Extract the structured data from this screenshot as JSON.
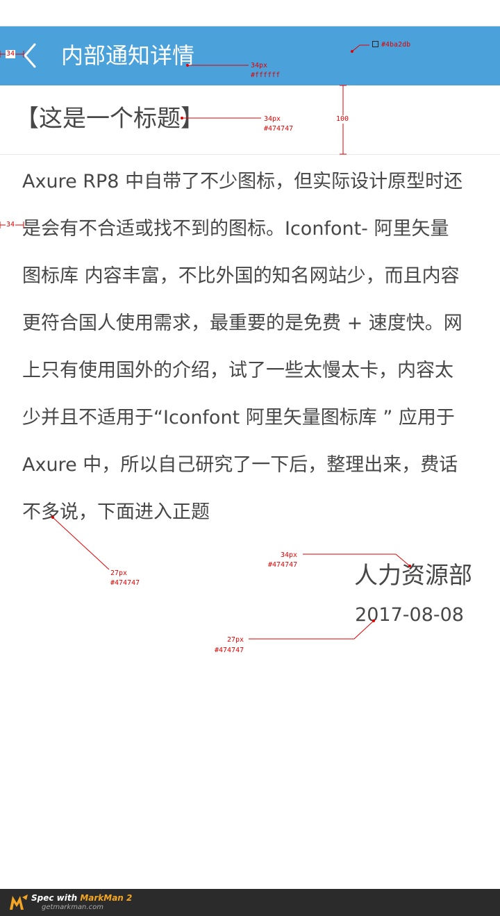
{
  "colors": {
    "nav_background": "#4ba2db",
    "nav_text": "#ffffff",
    "body_text": "#474747",
    "annotation": "#e10000",
    "footer_background": "#2b2b2b"
  },
  "nav": {
    "back_icon": "chevron-left-icon",
    "title": "内部通知详情"
  },
  "notice": {
    "title": "【这是一个标题】",
    "body_lines": [
      "Axure RP8 中自带了不少图标，但实际设计原型时还",
      "是会有不合适或找不到的图标。Iconfont- 阿里矢量",
      "图标库 内容丰富，不比外国的知名网站少，而且内容",
      "更符合国人使用需求，最重要的是免费 + 速度快。网",
      "上只有使用国外的介绍，试了一些太慢太卡，内容太",
      "少并且不适用于“Iconfont 阿里矢量图标库 ” 应用于",
      "Axure 中，所以自己研究了一下后，整理出来，费话",
      "不多说，下面进入正题"
    ],
    "department": "人力资源部",
    "date": "2017-08-08"
  },
  "annotations": {
    "margin_nav": "34",
    "margin_body": "34",
    "nav_title_size": "34px",
    "nav_title_color": "#ffffff",
    "nav_bg_color": "#4ba2db",
    "title_size": "34px",
    "title_color": "#474747",
    "title_row_height": "100",
    "body_size": "27px",
    "body_color": "#474747",
    "dept_size": "34px",
    "dept_color": "#474747",
    "date_size": "27px",
    "date_color": "#474747"
  },
  "footer": {
    "logo_icon": "markman-logo-icon",
    "brand_prefix": "Spec with ",
    "brand_name": "MarkMan 2",
    "url": "getmarkman.com"
  }
}
